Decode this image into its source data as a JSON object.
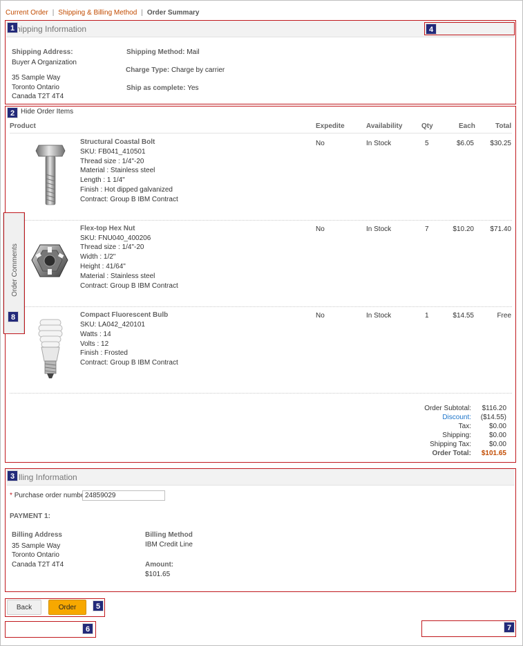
{
  "breadcrumb": {
    "items": [
      "Current Order",
      "Shipping & Billing Method",
      "Order Summary"
    ]
  },
  "badges": [
    "1",
    "2",
    "3",
    "4",
    "5",
    "6",
    "7",
    "8"
  ],
  "shipping": {
    "title": "hipping Information",
    "address_label": "Shipping Address:",
    "address_lines": [
      "Buyer A Organization",
      "35 Sample Way",
      "Toronto Ontario",
      "Canada T2T 4T4"
    ],
    "method_label": "Shipping Method:",
    "method_value": "Mail",
    "charge_label": "Charge Type:",
    "charge_value": "Charge by carrier",
    "complete_label": "Ship as complete:",
    "complete_value": "Yes"
  },
  "items_section": {
    "toggle_label": "Hide Order Items",
    "columns": [
      "Product",
      "Expedite",
      "Availability",
      "Qty",
      "Each",
      "Total"
    ],
    "products": [
      {
        "name": "Structural Coastal Bolt",
        "details": [
          "SKU: FB041_410501",
          "Thread size : 1/4\"-20",
          "Material : Stainless steel",
          "Length : 1 1/4\"",
          "Finish : Hot dipped galvanized",
          "Contract: Group B IBM Contract"
        ],
        "expedite": "No",
        "availability": "In Stock",
        "qty": "5",
        "each": "$6.05",
        "total": "$30.25",
        "icon": "bolt-icon"
      },
      {
        "name": "Flex-top Hex Nut",
        "details": [
          "SKU: FNU040_400206",
          "Thread size : 1/4\"-20",
          "Width : 1/2\"",
          "Height : 41/64\"",
          "Material : Stainless steel",
          "Contract: Group B IBM Contract"
        ],
        "expedite": "No",
        "availability": "In Stock",
        "qty": "7",
        "each": "$10.20",
        "total": "$71.40",
        "icon": "hex-nut-icon"
      },
      {
        "name": "Compact Fluorescent Bulb",
        "details": [
          "SKU: LA042_420101",
          "Watts : 14",
          "Volts : 12",
          "Finish : Frosted",
          "Contract: Group B IBM Contract"
        ],
        "expedite": "No",
        "availability": "In Stock",
        "qty": "1",
        "each": "$14.55",
        "total": "Free",
        "icon": "bulb-icon"
      }
    ],
    "totals": [
      {
        "label": "Order Subtotal:",
        "value": "$116.20"
      },
      {
        "label": "Discount:",
        "value": "($14.55)"
      },
      {
        "label": "Tax:",
        "value": "$0.00"
      },
      {
        "label": "Shipping:",
        "value": "$0.00"
      },
      {
        "label": "Shipping Tax:",
        "value": "$0.00"
      },
      {
        "label": "Order Total:",
        "value": "$101.65"
      }
    ]
  },
  "side_tab": {
    "label": "Order Comments"
  },
  "billing": {
    "title": "lling Information",
    "po_required_mark": "*",
    "po_label": "Purchase order number:",
    "po_value": "24859029",
    "payment_label": "PAYMENT 1:",
    "address_label": "Billing Address",
    "address_lines": [
      "35 Sample Way",
      "Toronto Ontario",
      "Canada T2T 4T4"
    ],
    "method_label": "Billing Method",
    "method_value": "IBM Credit Line",
    "amount_label": "Amount:",
    "amount_value": "$101.65"
  },
  "buttons": {
    "back": "Back",
    "order": "Order"
  },
  "colors": {
    "accent": "#c24b00",
    "badge": "#232a7a",
    "highlight_box": "#c0171c",
    "order_button": "#f7a800",
    "link": "#1a73c9"
  }
}
